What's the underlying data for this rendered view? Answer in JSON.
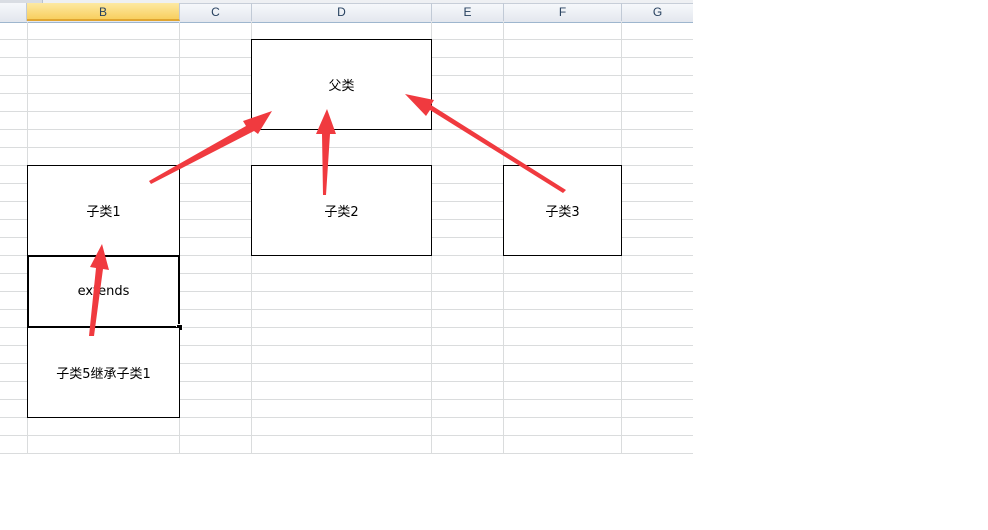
{
  "spreadsheet": {
    "columns": [
      "B",
      "C",
      "D",
      "E",
      "F",
      "G"
    ],
    "selected_column": "B"
  },
  "diagram": {
    "parent": "父类",
    "child1": "子类1",
    "child2": "子类2",
    "child3": "子类3",
    "extends_label": "extends",
    "child5": "子类5继承子类1"
  },
  "colors": {
    "arrow": "#f03a3f",
    "gridline": "#dadcdd",
    "header_selected": "#f8cf5f"
  }
}
